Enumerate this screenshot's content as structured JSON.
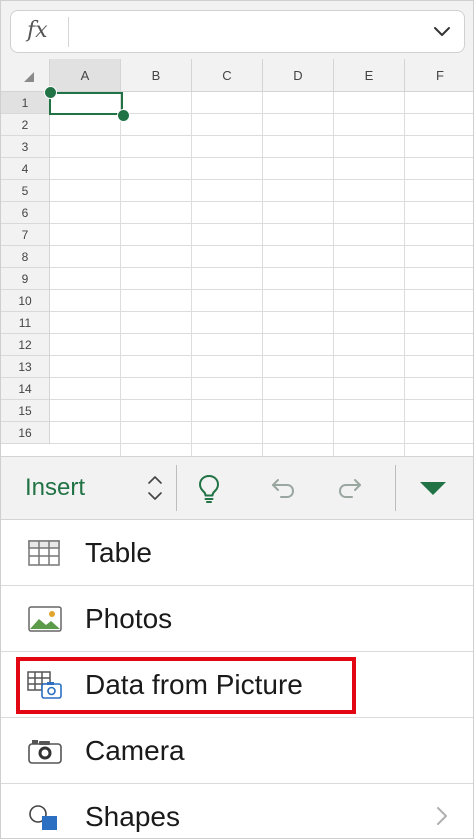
{
  "formula_bar": {
    "fx_label": "fx",
    "value": "",
    "expand_icon": "chevron-down-icon"
  },
  "grid": {
    "columns": [
      "A",
      "B",
      "C",
      "D",
      "E",
      "F"
    ],
    "rows": [
      "1",
      "2",
      "3",
      "4",
      "5",
      "6",
      "7",
      "8",
      "9",
      "10",
      "11",
      "12",
      "13",
      "14",
      "15",
      "16"
    ],
    "selected_cell": "A1"
  },
  "toolbar": {
    "tab_label": "Insert",
    "tab_switch_icon": "up-down-chevron-icon",
    "ideas_icon": "lightbulb-icon",
    "undo_icon": "undo-icon",
    "redo_icon": "redo-icon",
    "collapse_icon": "triangle-down-icon",
    "accent_color": "#217346"
  },
  "menu": {
    "items": [
      {
        "label": "Table",
        "icon": "table-icon"
      },
      {
        "label": "Photos",
        "icon": "photos-icon"
      },
      {
        "label": "Data from Picture",
        "icon": "data-from-picture-icon"
      },
      {
        "label": "Camera",
        "icon": "camera-icon"
      },
      {
        "label": "Shapes",
        "icon": "shapes-icon"
      }
    ],
    "highlight_color": "#e30613"
  }
}
